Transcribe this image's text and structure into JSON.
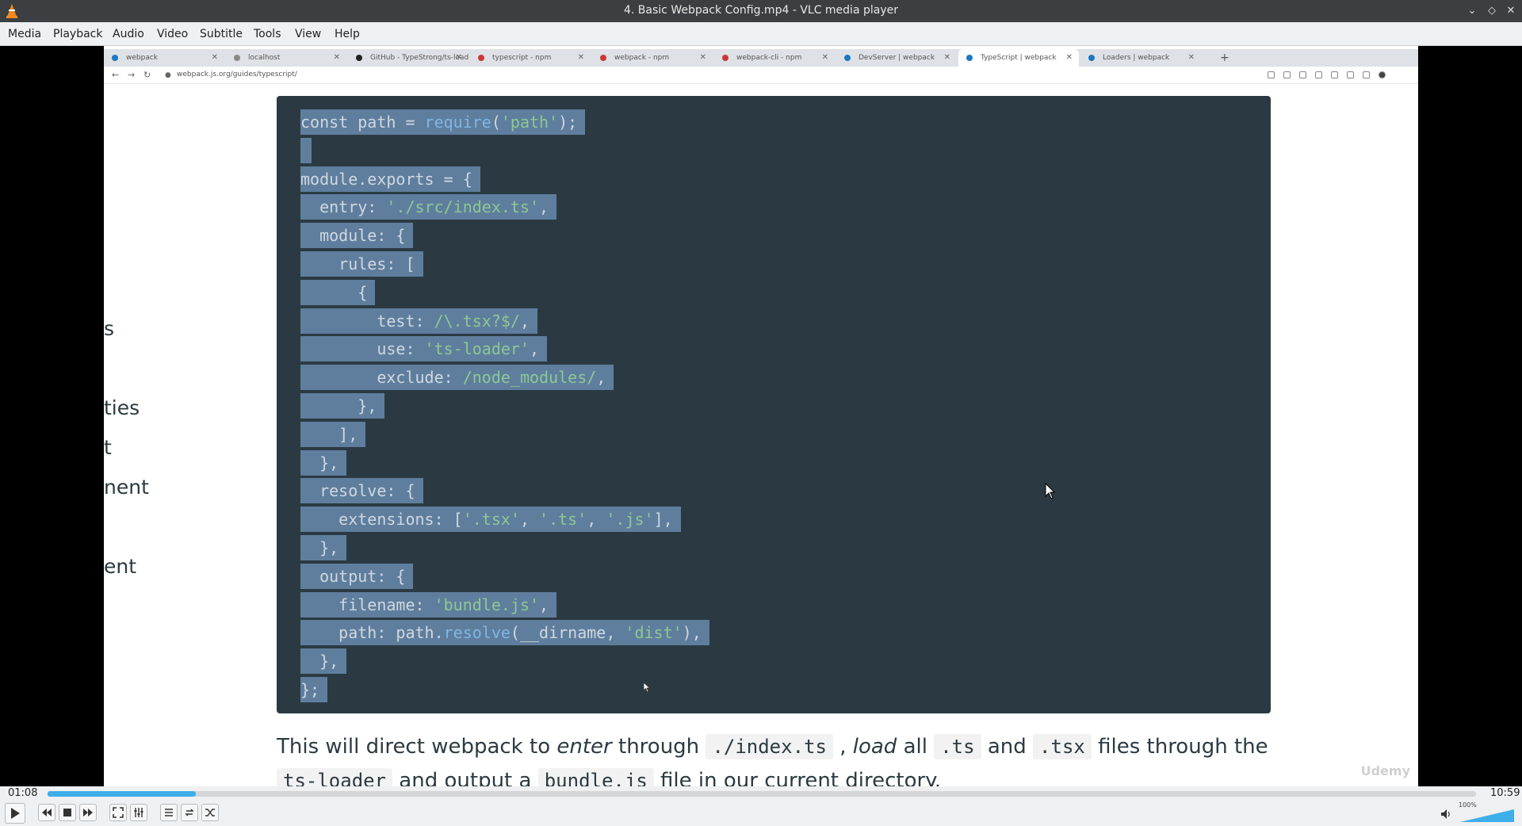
{
  "window": {
    "title": "4. Basic Webpack Config.mp4 - VLC media player"
  },
  "menu": [
    "Media",
    "Playback",
    "Audio",
    "Video",
    "Subtitle",
    "Tools",
    "View",
    "Help"
  ],
  "browser": {
    "tabs": [
      {
        "label": "webpack",
        "color": "#1c78c0"
      },
      {
        "label": "localhost",
        "color": "#888888"
      },
      {
        "label": "GitHub - TypeStrong/ts-loader",
        "color": "#222222"
      },
      {
        "label": "typescript - npm",
        "color": "#cb3837"
      },
      {
        "label": "webpack - npm",
        "color": "#cb3837"
      },
      {
        "label": "webpack-cli - npm",
        "color": "#cb3837"
      },
      {
        "label": "DevServer | webpack",
        "color": "#1c78c0"
      },
      {
        "label": "TypeScript | webpack",
        "color": "#1c78c0"
      },
      {
        "label": "Loaders | webpack",
        "color": "#1c78c0"
      }
    ],
    "active_tab": 7,
    "url": "webpack.js.org/guides/typescript/"
  },
  "left_fragments": [
    "s",
    "ties",
    "t",
    "nent",
    "ent"
  ],
  "code_lines": [
    [
      {
        "t": "const path = ",
        "c": "kw"
      },
      {
        "t": "require",
        "c": "fn"
      },
      {
        "t": "(",
        "c": "kw"
      },
      {
        "t": "'path'",
        "c": "str"
      },
      {
        "t": ");",
        "c": "kw"
      }
    ],
    [],
    [
      {
        "t": "module.exports = {",
        "c": "kw"
      }
    ],
    [
      {
        "t": "  entry: ",
        "c": "kw"
      },
      {
        "t": "'./src/index.ts'",
        "c": "str"
      },
      {
        "t": ",",
        "c": "kw"
      }
    ],
    [
      {
        "t": "  module: {",
        "c": "kw"
      }
    ],
    [
      {
        "t": "    rules: [",
        "c": "kw"
      }
    ],
    [
      {
        "t": "      {",
        "c": "kw"
      }
    ],
    [
      {
        "t": "        test: ",
        "c": "kw"
      },
      {
        "t": "/\\.tsx?$/",
        "c": "str"
      },
      {
        "t": ",",
        "c": "kw"
      }
    ],
    [
      {
        "t": "        use: ",
        "c": "kw"
      },
      {
        "t": "'ts-loader'",
        "c": "str"
      },
      {
        "t": ",",
        "c": "kw"
      }
    ],
    [
      {
        "t": "        exclude: ",
        "c": "kw"
      },
      {
        "t": "/node_modules/",
        "c": "str"
      },
      {
        "t": ",",
        "c": "kw"
      }
    ],
    [
      {
        "t": "      },",
        "c": "kw"
      }
    ],
    [
      {
        "t": "    ],",
        "c": "kw"
      }
    ],
    [
      {
        "t": "  },",
        "c": "kw"
      }
    ],
    [
      {
        "t": "  resolve: {",
        "c": "kw"
      }
    ],
    [
      {
        "t": "    extensions: [",
        "c": "kw"
      },
      {
        "t": "'.tsx'",
        "c": "str"
      },
      {
        "t": ", ",
        "c": "kw"
      },
      {
        "t": "'.ts'",
        "c": "str"
      },
      {
        "t": ", ",
        "c": "kw"
      },
      {
        "t": "'.js'",
        "c": "str"
      },
      {
        "t": "],",
        "c": "kw"
      }
    ],
    [
      {
        "t": "  },",
        "c": "kw"
      }
    ],
    [
      {
        "t": "  output: {",
        "c": "kw"
      }
    ],
    [
      {
        "t": "    filename: ",
        "c": "kw"
      },
      {
        "t": "'bundle.js'",
        "c": "str"
      },
      {
        "t": ",",
        "c": "kw"
      }
    ],
    [
      {
        "t": "    path: path.",
        "c": "kw"
      },
      {
        "t": "resolve",
        "c": "fn"
      },
      {
        "t": "(__dirname, ",
        "c": "kw"
      },
      {
        "t": "'dist'",
        "c": "str"
      },
      {
        "t": "),",
        "c": "kw"
      }
    ],
    [
      {
        "t": "  },",
        "c": "kw"
      }
    ],
    [
      {
        "t": "};",
        "c": "kw"
      }
    ]
  ],
  "paragraph": {
    "p1": "This will direct webpack to ",
    "enter": "enter",
    "p2": " through ",
    "c1": "./index.ts",
    "p3": " , ",
    "load": "load",
    "p4": " all ",
    "c2": ".ts",
    "p5": " and ",
    "c3": ".tsx",
    "p6": " files through the",
    "c4": "ts-loader",
    "p7": " and output a ",
    "c5": "bundle.js",
    "p8": " file in our current directory."
  },
  "watermark": "Udemy",
  "player": {
    "elapsed": "01:08",
    "total": "10:59",
    "progress": 0.104,
    "volume_label": "100%",
    "volume": 1.0,
    "accent": "#3daee9"
  }
}
